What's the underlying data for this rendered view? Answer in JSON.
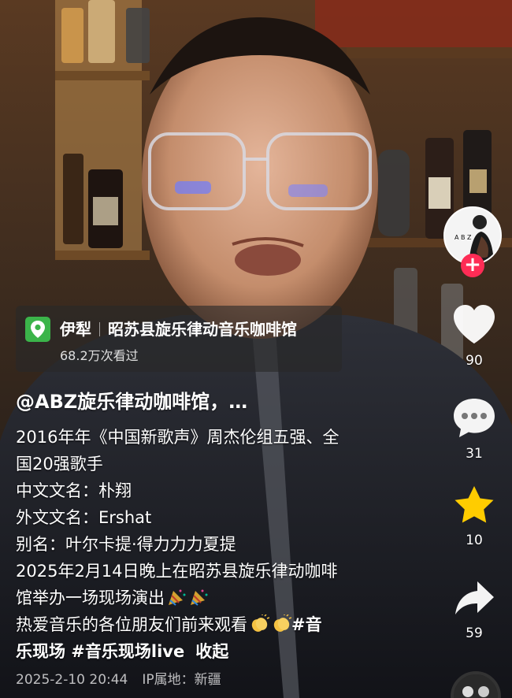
{
  "location": {
    "city": "伊犁",
    "place": "昭苏县旋乐律动音乐咖啡馆",
    "views": "68.2万次看过"
  },
  "post": {
    "author": "@ABZ旋乐律动咖啡馆，…",
    "lines": [
      "2016年年《中国新歌声》周杰伦组五强、全",
      "国20强歌手",
      "中文文名：朴翔",
      "外文文名：Ershat",
      "别名：叶尔卡提·得力力力夏提",
      "2025年2月14日晚上在昭苏县旋乐律动咖啡",
      "馆举办一场现场演出",
      "热爱音乐的各位朋友们前来观看",
      "#音",
      "乐现场 #音乐现场live",
      "收起"
    ],
    "date": "2025-2-10 20:44",
    "ip": "IP属地：新疆"
  },
  "rail": {
    "avatar_text": "A B Z",
    "follow": "+",
    "likes": "90",
    "comments": "31",
    "favorites": "10",
    "shares": "59"
  },
  "colors": {
    "accent": "#fe2c55",
    "location_pin": "#3bb44a",
    "star": "#ffcc00"
  },
  "icons": [
    "location-pin-icon",
    "heart-icon",
    "comment-bubble-icon",
    "star-icon",
    "share-arrow-icon",
    "clapping-hands-icon",
    "party-popper-icon"
  ]
}
